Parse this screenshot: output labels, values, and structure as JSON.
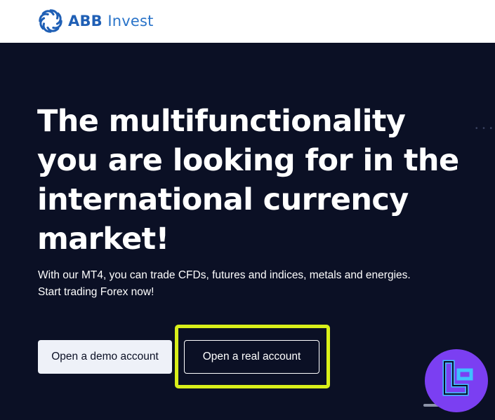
{
  "header": {
    "logo_bold": "ABB",
    "logo_light": "Invest"
  },
  "hero": {
    "headline": "The multifunctionality you are looking for in the international currency market!",
    "subtext_line1": "With our MT4, you can trade CFDs, futures and indices, metals and energies.",
    "subtext_line2": "Start trading Forex now!",
    "demo_button": "Open a demo account",
    "real_button": "Open a real account"
  },
  "colors": {
    "header_bg": "#ffffff",
    "hero_bg": "#0b1025",
    "brand_blue": "#1f5fb5",
    "highlight": "#d9ef1a",
    "badge": "#7b3ff2"
  },
  "icons": {
    "logo": "abb-swirl-logo-icon",
    "badge": "tc-badge-icon"
  }
}
